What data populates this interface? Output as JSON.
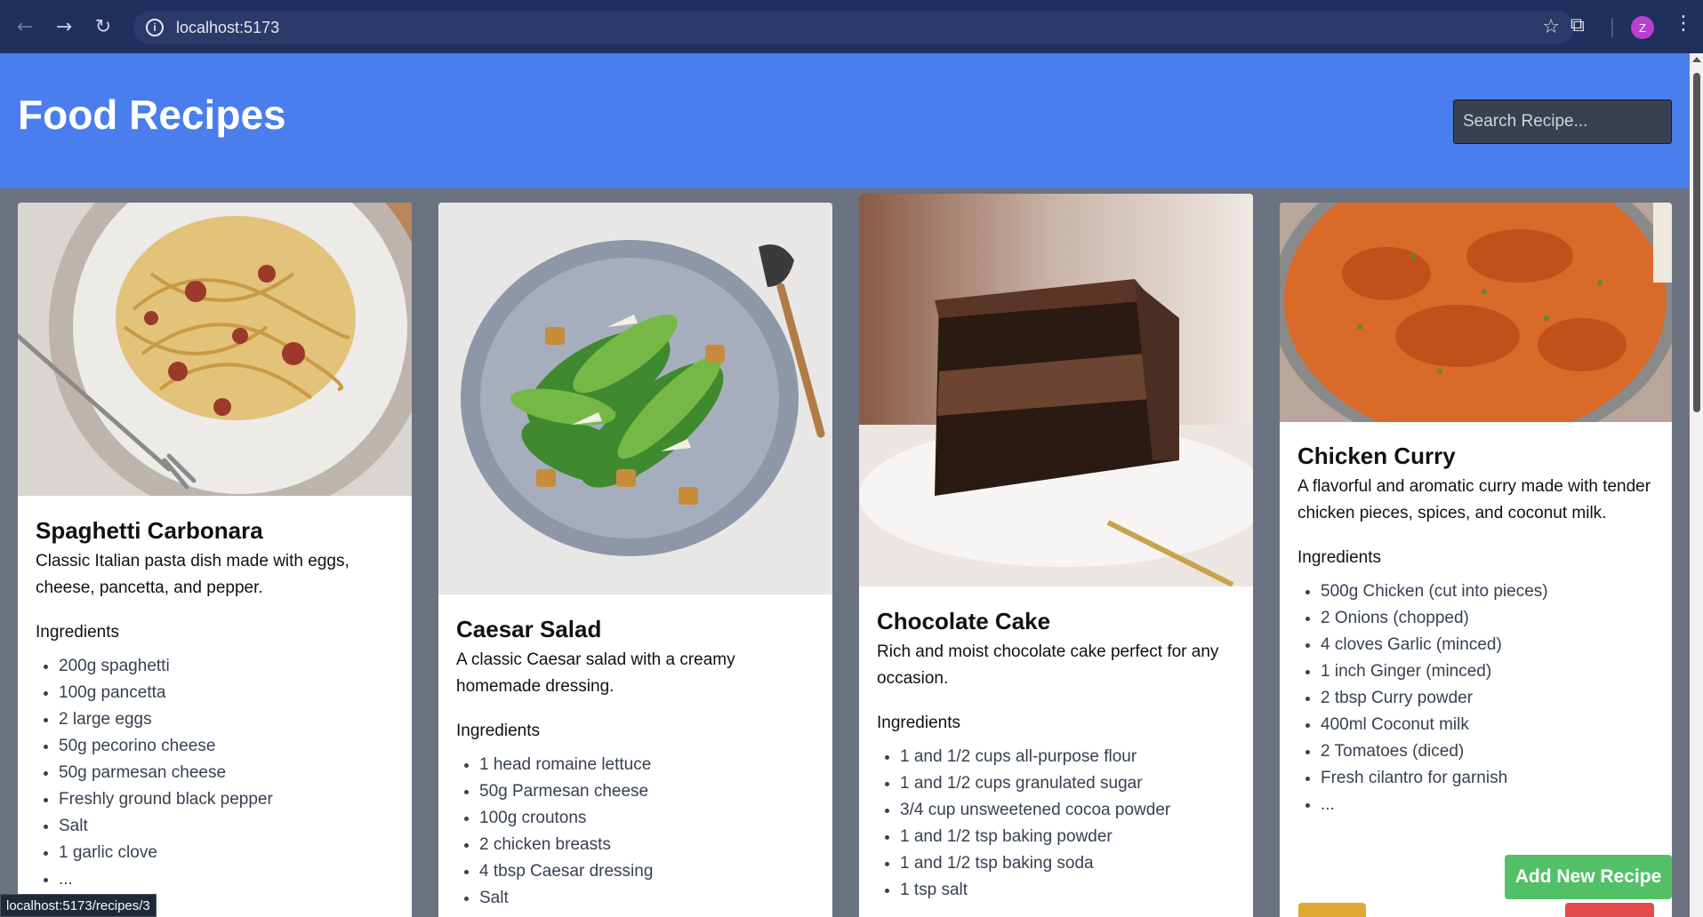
{
  "browser": {
    "url": "localhost:5173",
    "avatar_initial": "Z",
    "status_url": "localhost:5173/recipes/3"
  },
  "app": {
    "title": "Food Recipes",
    "search_placeholder": "Search Recipe...",
    "add_button": "Add New Recipe"
  },
  "recipes": [
    {
      "name": "Spaghetti Carbonara",
      "description": "Classic Italian pasta dish made with eggs, cheese, pancetta, and pepper.",
      "ingredients_label": "Ingredients",
      "ingredients": [
        "200g spaghetti",
        "100g pancetta",
        "2 large eggs",
        "50g pecorino cheese",
        "50g parmesan cheese",
        "Freshly ground black pepper",
        "Salt",
        "1 garlic clove",
        "..."
      ]
    },
    {
      "name": "Caesar Salad",
      "description": "A classic Caesar salad with a creamy homemade dressing.",
      "ingredients_label": "Ingredients",
      "ingredients": [
        "1 head romaine lettuce",
        "50g Parmesan cheese",
        "100g croutons",
        "2 chicken breasts",
        "4 tbsp Caesar dressing",
        "Salt"
      ]
    },
    {
      "name": "Chocolate Cake",
      "description": "Rich and moist chocolate cake perfect for any occasion.",
      "ingredients_label": "Ingredients",
      "ingredients": [
        "1 and 1/2 cups all-purpose flour",
        "1 and 1/2 cups granulated sugar",
        "3/4 cup unsweetened cocoa powder",
        "1 and 1/2 tsp baking powder",
        "1 and 1/2 tsp baking soda",
        "1 tsp salt"
      ]
    },
    {
      "name": "Chicken Curry",
      "description": "A flavorful and aromatic curry made with tender chicken pieces, spices, and coconut milk.",
      "ingredients_label": "Ingredients",
      "ingredients": [
        "500g Chicken (cut into pieces)",
        "2 Onions (chopped)",
        "4 cloves Garlic (minced)",
        "1 inch Ginger (minced)",
        "2 tbsp Curry powder",
        "400ml Coconut milk",
        "2 Tomatoes (diced)",
        "Fresh cilantro for garnish",
        "..."
      ]
    }
  ]
}
